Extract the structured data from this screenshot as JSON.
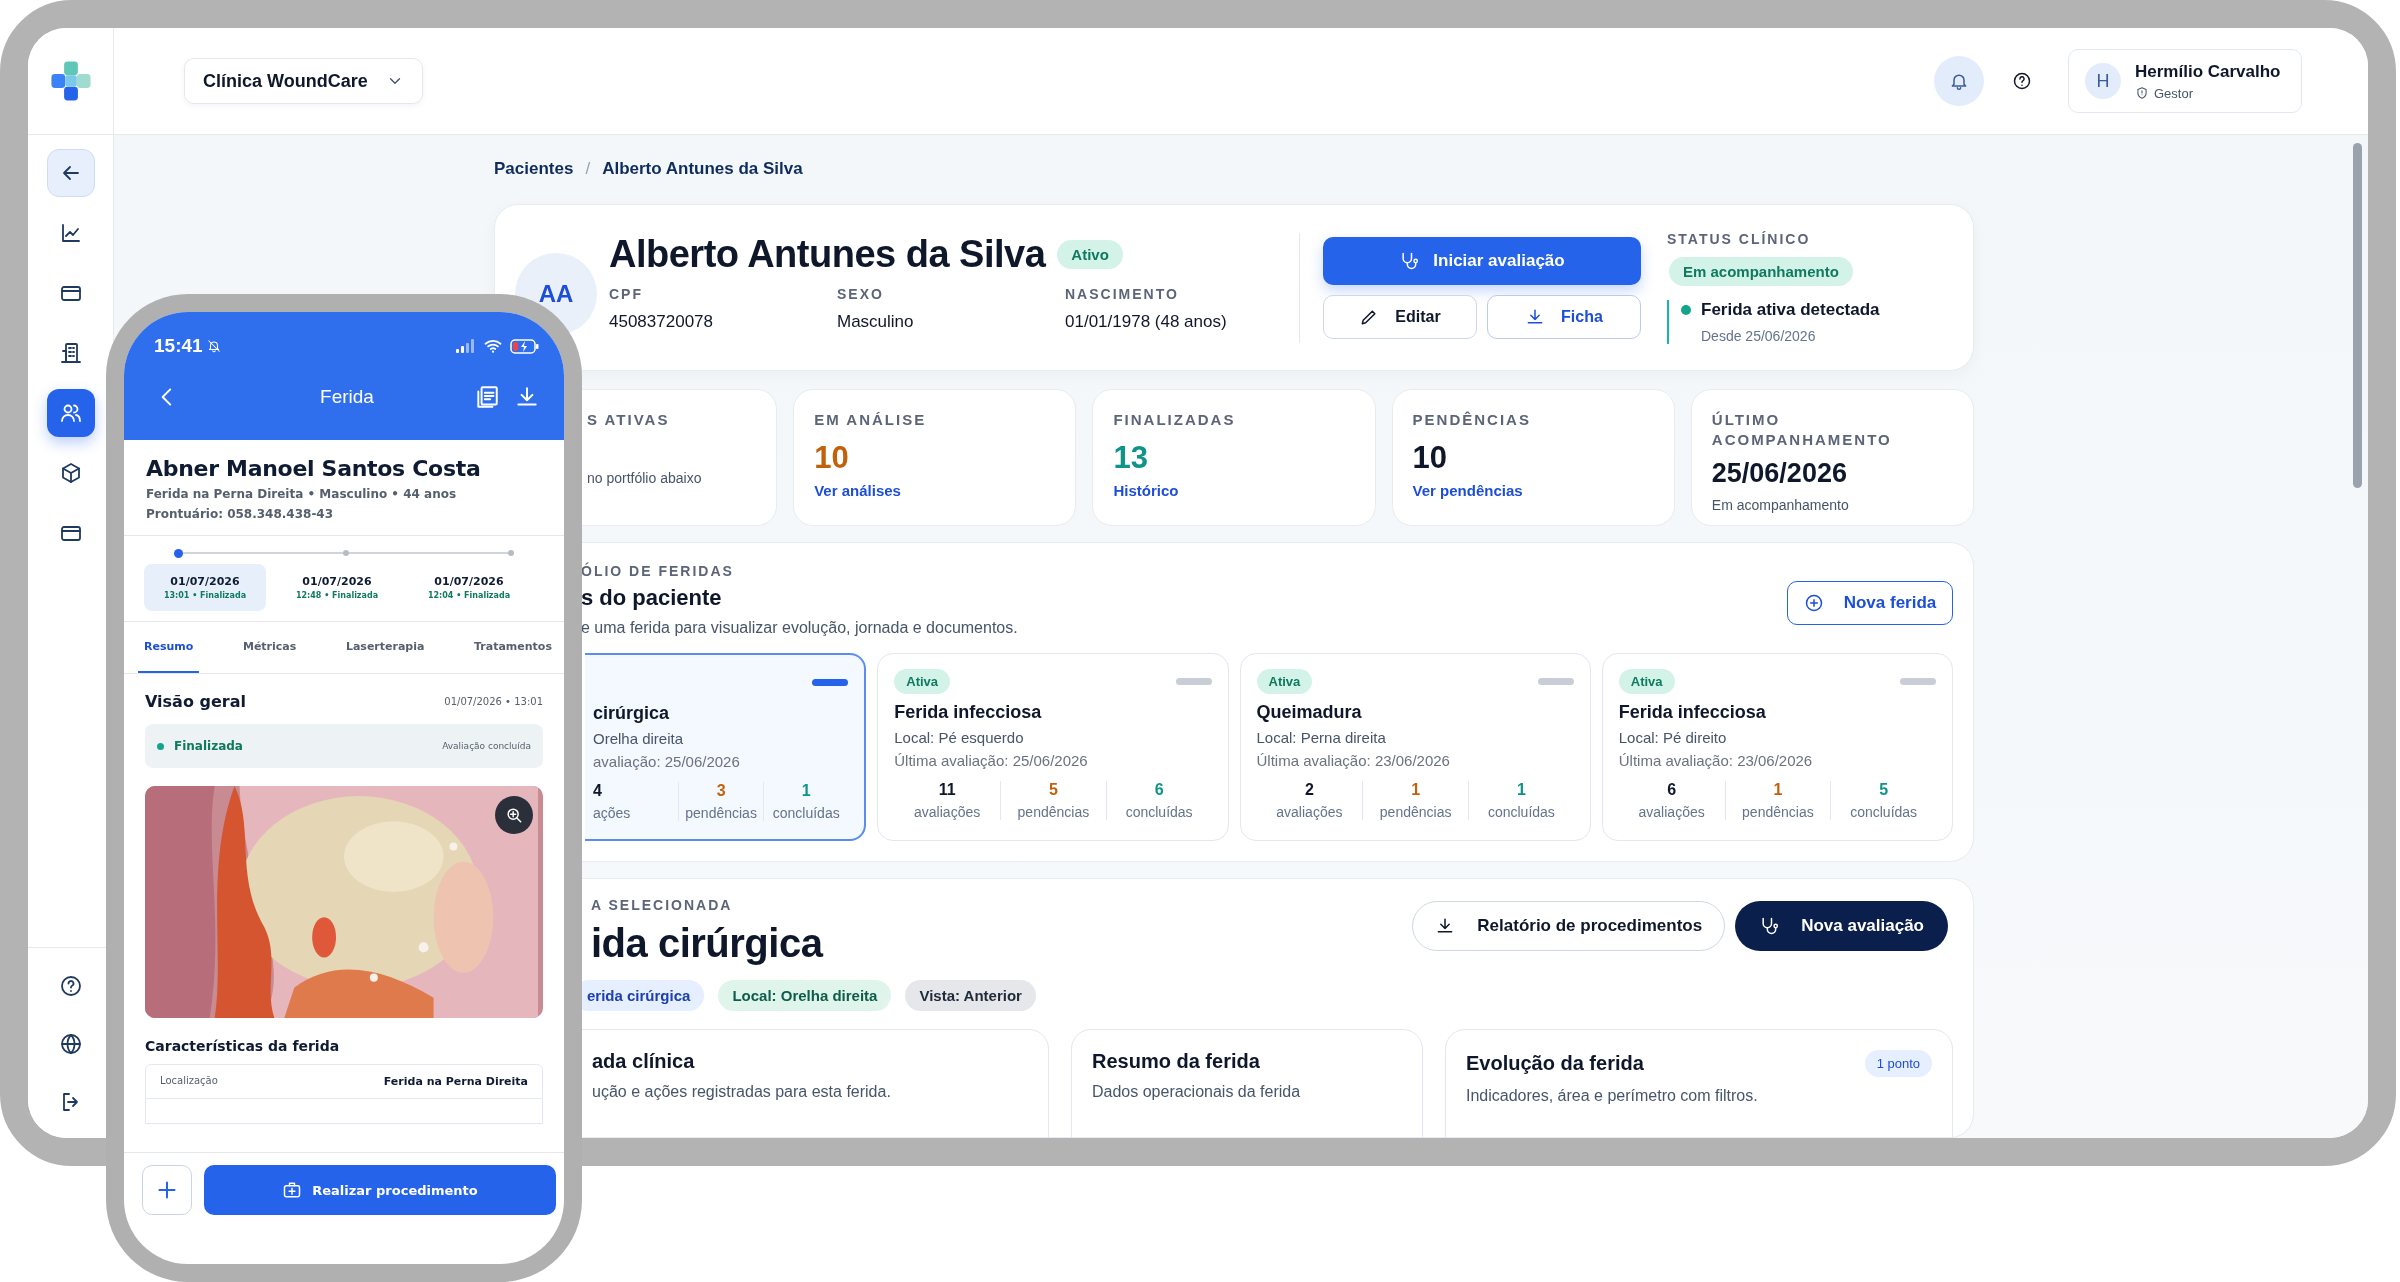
{
  "sidebar": {
    "nav": [
      {
        "kind": "back",
        "selected": false
      },
      {
        "kind": "chart",
        "selected": false
      },
      {
        "kind": "card",
        "selected": false
      },
      {
        "kind": "building",
        "selected": false
      },
      {
        "kind": "users",
        "selected": true
      },
      {
        "kind": "box",
        "selected": false
      },
      {
        "kind": "card",
        "selected": false
      }
    ],
    "footer": [
      {
        "kind": "help"
      },
      {
        "kind": "globe"
      },
      {
        "kind": "logout"
      }
    ]
  },
  "topbar": {
    "clinic": "Clínica WoundCare",
    "user": {
      "initial": "H",
      "name": "Hermílio Carvalho",
      "role": "Gestor"
    }
  },
  "breadcrumb": {
    "items": [
      "Pacientes",
      "Alberto Antunes da Silva"
    ],
    "separator": "/"
  },
  "patient": {
    "initials": "AA",
    "name": "Alberto Antunes da Silva",
    "status": "Ativo",
    "fields": [
      {
        "label": "CPF",
        "value": "45083720078"
      },
      {
        "label": "SEXO",
        "value": "Masculino"
      },
      {
        "label": "NASCIMENTO",
        "value": "01/01/1978 (48 anos)"
      }
    ],
    "primary_action": "Iniciar avaliação",
    "actions": [
      {
        "kind": "edit",
        "label": "Editar"
      },
      {
        "kind": "download",
        "label": "Ficha"
      }
    ],
    "clinical_status": {
      "title": "STATUS CLÍNICO",
      "badge": "Em acompanhamento",
      "alert": "Ferida ativa detectada",
      "since": "Desde 25/06/2026"
    }
  },
  "stats": [
    {
      "label": "S ATIVAS",
      "note": "no portfólio abaixo"
    },
    {
      "label": "EM ANÁLISE",
      "value": "10",
      "color": "#c2610c",
      "link": "Ver análises"
    },
    {
      "label": "FINALIZADAS",
      "value": "13",
      "color": "#0f9488",
      "link": "Histórico"
    },
    {
      "label": "PENDÊNCIAS",
      "value": "10",
      "color": "#0f172a",
      "link": "Ver pendências"
    },
    {
      "label": "ÚLTIMO ACOMPANHAMENTO",
      "value": "25/06/2026",
      "color": "#0f172a",
      "note": "Em acompanhamento"
    }
  ],
  "portfolio": {
    "label": "ÓLIO DE FERIDAS",
    "title": "s do paciente",
    "subtitle": "e uma ferida para visualizar evolução, jornada e documentos.",
    "button": "Nova ferida",
    "wounds": [
      {
        "selected": true,
        "title": "cirúrgica",
        "location": "Orelha direita",
        "last_evaluation": "avaliação: 25/06/2026",
        "stats": [
          {
            "kind": "evaluations",
            "value": "4",
            "label": "ações"
          },
          {
            "kind": "pending",
            "value": "3",
            "label": "pendências"
          },
          {
            "kind": "done",
            "value": "1",
            "label": "concluídas"
          }
        ]
      },
      {
        "selected": false,
        "status": "Ativa",
        "title": "Ferida infecciosa",
        "location": "Local: Pé esquerdo",
        "last_evaluation": "Última avaliação: 25/06/2026",
        "stats": [
          {
            "kind": "evaluations",
            "value": "11",
            "label": "avaliações"
          },
          {
            "kind": "pending",
            "value": "5",
            "label": "pendências"
          },
          {
            "kind": "done",
            "value": "6",
            "label": "concluídas"
          }
        ]
      },
      {
        "selected": false,
        "status": "Ativa",
        "title": "Queimadura",
        "location": "Local: Perna direita",
        "last_evaluation": "Última avaliação: 23/06/2026",
        "stats": [
          {
            "kind": "evaluations",
            "value": "2",
            "label": "avaliações"
          },
          {
            "kind": "pending",
            "value": "1",
            "label": "pendências"
          },
          {
            "kind": "done",
            "value": "1",
            "label": "concluídas"
          }
        ]
      },
      {
        "selected": false,
        "status": "Ativa",
        "title": "Ferida infecciosa",
        "location": "Local: Pé direito",
        "last_evaluation": "Última avaliação: 23/06/2026",
        "stats": [
          {
            "kind": "evaluations",
            "value": "6",
            "label": "avaliações"
          },
          {
            "kind": "pending",
            "value": "1",
            "label": "pendências"
          },
          {
            "kind": "done",
            "value": "5",
            "label": "concluídas"
          }
        ]
      }
    ]
  },
  "selected_wound": {
    "label": "A SELECIONADA",
    "title": "ida cirúrgica",
    "actions": [
      {
        "kind": "outline",
        "label": "Relatório de procedimentos"
      },
      {
        "kind": "dark",
        "label": "Nova avaliação"
      }
    ],
    "tags": [
      {
        "text": "erida cirúrgica",
        "color": "#e6efff"
      },
      {
        "text": "Local: Orelha direita",
        "color": "#dff5ec"
      },
      {
        "text": "Vista: Anterior",
        "color": "#e5e7eb"
      }
    ],
    "cards": [
      {
        "title": "ada clínica",
        "subtitle": "ução e ações registradas para esta ferida."
      },
      {
        "title": "Resumo da ferida",
        "subtitle": "Dados operacionais da ferida"
      },
      {
        "title": "Evolução da ferida",
        "subtitle": "Indicadores, área e perímetro com filtros.",
        "badge": "1 ponto"
      }
    ]
  },
  "phone": {
    "time": "15:41",
    "title": "Ferida",
    "patient": {
      "name": "Abner Manoel Santos Costa",
      "details": "Ferida na Perna Direita  •  Masculino  •  44 anos",
      "record": "Prontuário: 058.348.438-43"
    },
    "sessions": [
      {
        "date": "01/07/2026",
        "info": "13:01  •  Finalizada",
        "selected": true
      },
      {
        "date": "01/07/2026",
        "info": "12:48  •  Finalizada",
        "selected": false
      },
      {
        "date": "01/07/2026",
        "info": "12:04  •  Finalizada",
        "selected": false
      }
    ],
    "tabs": [
      {
        "label": "Resumo",
        "selected": true
      },
      {
        "label": "Métricas",
        "selected": false
      },
      {
        "label": "Laserterapia",
        "selected": false
      },
      {
        "label": "Tratamentos",
        "selected": false
      }
    ],
    "overview": {
      "title": "Visão geral",
      "datetime": "01/07/2026  •  13:01",
      "status": "Finalizada",
      "note": "Avaliação concluída"
    },
    "characteristics": {
      "title": "Características da ferida",
      "rows": [
        {
          "label": "Localização",
          "value": "Ferida na Perna Direita"
        }
      ]
    },
    "primary_action": "Realizar procedimento"
  }
}
